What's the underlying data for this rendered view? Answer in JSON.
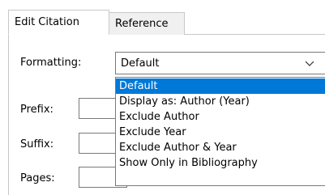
{
  "tabs": [
    {
      "label": "Edit Citation",
      "active": true
    },
    {
      "label": "Reference",
      "active": false
    }
  ],
  "form": {
    "formatting_label": "Formatting:",
    "prefix_label": "Prefix:",
    "suffix_label": "Suffix:",
    "pages_label": "Pages:"
  },
  "formatting_select": {
    "value": "Default",
    "options": [
      "Default",
      "Display as: Author (Year)",
      "Exclude Author",
      "Exclude Year",
      "Exclude Author & Year",
      "Show Only in Bibliography"
    ],
    "highlighted_index": 0
  },
  "icons": {
    "dropdown_arrow": "chevron-down-icon"
  },
  "colors": {
    "selection": "#0078d7",
    "border": "#7a7a7a",
    "tab_inactive_bg": "#f0f0f0"
  }
}
